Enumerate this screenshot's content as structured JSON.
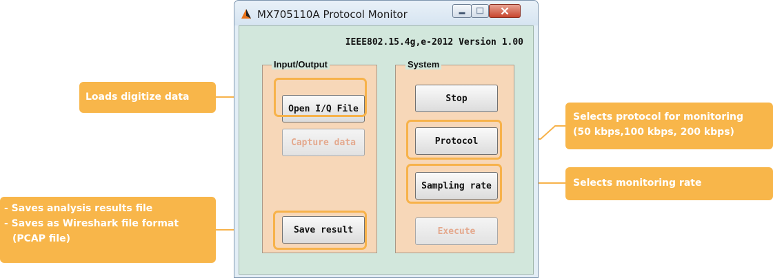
{
  "window": {
    "title": "MX705110A Protocol Monitor",
    "version_text": "IEEE802.15.4g,e-2012 Version 1.00"
  },
  "groups": {
    "io_label": "Input/Output",
    "system_label": "System"
  },
  "buttons": {
    "open_iq": "Open I/Q File",
    "capture_data": "Capture data",
    "save_result": "Save result",
    "stop": "Stop",
    "protocol": "Protocol",
    "sampling_rate": "Sampling rate",
    "execute": "Execute"
  },
  "callouts": {
    "loads": "Loads digitize data",
    "protocol_line1": "Selects protocol for monitoring",
    "protocol_line2": "(50 kbps,100 kbps, 200 kbps)",
    "rate": "Selects monitoring rate",
    "save_line1": "- Saves analysis results file",
    "save_line2": "- Saves as Wireshark file format",
    "save_line3": "(PCAP file)"
  },
  "colors": {
    "callout": "#f8b64a",
    "highlight": "#f7b24a",
    "group_fill": "#f7d7b8",
    "client_fill": "#d2e7dc"
  }
}
